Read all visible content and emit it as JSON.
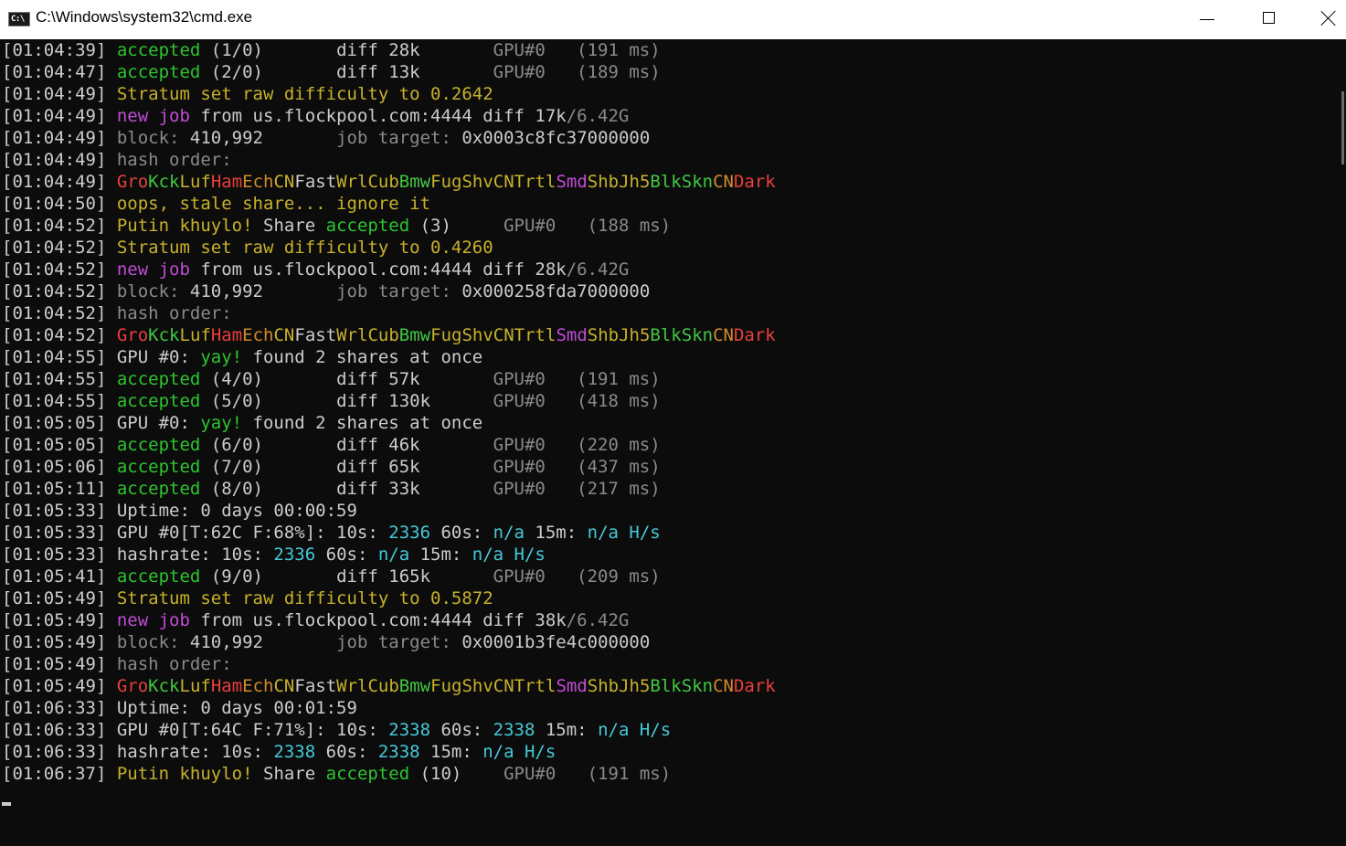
{
  "window": {
    "title": "C:\\Windows\\system32\\cmd.exe",
    "icon": "cmd-app-icon",
    "icon_text": "C:\\"
  },
  "colors": {
    "w": "#cccccc",
    "g": "#2ec52e",
    "y": "#c8b12c",
    "r": "#e8403c",
    "m": "#c24bd6",
    "d": "#8a8a8a",
    "c": "#47c8d8",
    "o": "#d08a2a",
    "W": "#f2f2f2",
    "G": "#40c840"
  },
  "console": {
    "lines": [
      [
        [
          "w",
          "[01:04:39] "
        ],
        [
          "g",
          "accepted"
        ],
        [
          "w",
          " (1/0)       diff 28k       "
        ],
        [
          "d",
          "GPU#0   (191 ms)"
        ]
      ],
      [
        [
          "w",
          "[01:04:47] "
        ],
        [
          "g",
          "accepted"
        ],
        [
          "w",
          " (2/0)       diff 13k       "
        ],
        [
          "d",
          "GPU#0   (189 ms)"
        ]
      ],
      [
        [
          "w",
          "[01:04:49] "
        ],
        [
          "y",
          "Stratum set raw difficulty to 0.2642"
        ]
      ],
      [
        [
          "w",
          "[01:04:49] "
        ],
        [
          "m",
          "new job"
        ],
        [
          "w",
          " from us.flockpool.com:4444 diff 17k"
        ],
        [
          "d",
          "/6.42G"
        ]
      ],
      [
        [
          "w",
          "[01:04:49] "
        ],
        [
          "d",
          "block: "
        ],
        [
          "w",
          "410,992       "
        ],
        [
          "d",
          "job target: "
        ],
        [
          "w",
          "0x0003c8fc37000000"
        ]
      ],
      [
        [
          "w",
          "[01:04:49] "
        ],
        [
          "d",
          "hash order:"
        ]
      ],
      [
        [
          "w",
          "[01:04:49] "
        ],
        [
          "r",
          "Gro"
        ],
        [
          "G",
          "Kck"
        ],
        [
          "y",
          "Luf"
        ],
        [
          "r",
          "Ham"
        ],
        [
          "o",
          "Ech"
        ],
        [
          "y",
          "CN"
        ],
        [
          "w",
          "Fast"
        ],
        [
          "y",
          "Wrl"
        ],
        [
          "y",
          "Cub"
        ],
        [
          "G",
          "Bmw"
        ],
        [
          "y",
          "Fug"
        ],
        [
          "y",
          "Shv"
        ],
        [
          "y",
          "CN"
        ],
        [
          "y",
          "Trtl"
        ],
        [
          "m",
          "Smd"
        ],
        [
          "y",
          "Shb"
        ],
        [
          "y",
          "Jh5"
        ],
        [
          "G",
          "Blk"
        ],
        [
          "G",
          "Skn"
        ],
        [
          "o",
          "CN"
        ],
        [
          "r",
          "Dark"
        ]
      ],
      [
        [
          "w",
          "[01:04:50] "
        ],
        [
          "y",
          "oops, stale share... ignore it"
        ]
      ],
      [
        [
          "w",
          "[01:04:52] "
        ],
        [
          "y",
          "Putin khuylo!"
        ],
        [
          "w",
          " Share "
        ],
        [
          "g",
          "accepted"
        ],
        [
          "w",
          " (3)     "
        ],
        [
          "d",
          "GPU#0   (188 ms)"
        ]
      ],
      [
        [
          "w",
          "[01:04:52] "
        ],
        [
          "y",
          "Stratum set raw difficulty to 0.4260"
        ]
      ],
      [
        [
          "w",
          "[01:04:52] "
        ],
        [
          "m",
          "new job"
        ],
        [
          "w",
          " from us.flockpool.com:4444 diff 28k"
        ],
        [
          "d",
          "/6.42G"
        ]
      ],
      [
        [
          "w",
          "[01:04:52] "
        ],
        [
          "d",
          "block: "
        ],
        [
          "w",
          "410,992       "
        ],
        [
          "d",
          "job target: "
        ],
        [
          "w",
          "0x000258fda7000000"
        ]
      ],
      [
        [
          "w",
          "[01:04:52] "
        ],
        [
          "d",
          "hash order:"
        ]
      ],
      [
        [
          "w",
          "[01:04:52] "
        ],
        [
          "r",
          "Gro"
        ],
        [
          "G",
          "Kck"
        ],
        [
          "y",
          "Luf"
        ],
        [
          "r",
          "Ham"
        ],
        [
          "o",
          "Ech"
        ],
        [
          "y",
          "CN"
        ],
        [
          "w",
          "Fast"
        ],
        [
          "y",
          "Wrl"
        ],
        [
          "y",
          "Cub"
        ],
        [
          "G",
          "Bmw"
        ],
        [
          "y",
          "Fug"
        ],
        [
          "y",
          "Shv"
        ],
        [
          "y",
          "CN"
        ],
        [
          "y",
          "Trtl"
        ],
        [
          "m",
          "Smd"
        ],
        [
          "y",
          "Shb"
        ],
        [
          "y",
          "Jh5"
        ],
        [
          "G",
          "Blk"
        ],
        [
          "G",
          "Skn"
        ],
        [
          "o",
          "CN"
        ],
        [
          "r",
          "Dark"
        ]
      ],
      [
        [
          "w",
          "[01:04:55] GPU #0: "
        ],
        [
          "g",
          "yay!"
        ],
        [
          "w",
          " found 2 shares at once"
        ]
      ],
      [
        [
          "w",
          "[01:04:55] "
        ],
        [
          "g",
          "accepted"
        ],
        [
          "w",
          " (4/0)       diff 57k       "
        ],
        [
          "d",
          "GPU#0   (191 ms)"
        ]
      ],
      [
        [
          "w",
          "[01:04:55] "
        ],
        [
          "g",
          "accepted"
        ],
        [
          "w",
          " (5/0)       diff 130k      "
        ],
        [
          "d",
          "GPU#0   (418 ms)"
        ]
      ],
      [
        [
          "w",
          "[01:05:05] GPU #0: "
        ],
        [
          "g",
          "yay!"
        ],
        [
          "w",
          " found 2 shares at once"
        ]
      ],
      [
        [
          "w",
          "[01:05:05] "
        ],
        [
          "g",
          "accepted"
        ],
        [
          "w",
          " (6/0)       diff 46k       "
        ],
        [
          "d",
          "GPU#0   (220 ms)"
        ]
      ],
      [
        [
          "w",
          "[01:05:06] "
        ],
        [
          "g",
          "accepted"
        ],
        [
          "w",
          " (7/0)       diff 65k       "
        ],
        [
          "d",
          "GPU#0   (437 ms)"
        ]
      ],
      [
        [
          "w",
          "[01:05:11] "
        ],
        [
          "g",
          "accepted"
        ],
        [
          "w",
          " (8/0)       diff 33k       "
        ],
        [
          "d",
          "GPU#0   (217 ms)"
        ]
      ],
      [
        [
          "w",
          "[01:05:33] Uptime: 0 days 00:00:59"
        ]
      ],
      [
        [
          "w",
          "[01:05:33] GPU #0[T:62C F:68%]: 10s: "
        ],
        [
          "c",
          "2336"
        ],
        [
          "w",
          " 60s: "
        ],
        [
          "c",
          "n/a"
        ],
        [
          "w",
          " 15m: "
        ],
        [
          "c",
          "n/a H/s"
        ]
      ],
      [
        [
          "w",
          "[01:05:33] hashrate: 10s: "
        ],
        [
          "c",
          "2336"
        ],
        [
          "w",
          " 60s: "
        ],
        [
          "c",
          "n/a"
        ],
        [
          "w",
          " 15m: "
        ],
        [
          "c",
          "n/a H/s"
        ]
      ],
      [
        [
          "w",
          "[01:05:41] "
        ],
        [
          "g",
          "accepted"
        ],
        [
          "w",
          " (9/0)       diff 165k      "
        ],
        [
          "d",
          "GPU#0   (209 ms)"
        ]
      ],
      [
        [
          "w",
          "[01:05:49] "
        ],
        [
          "y",
          "Stratum set raw difficulty to 0.5872"
        ]
      ],
      [
        [
          "w",
          "[01:05:49] "
        ],
        [
          "m",
          "new job"
        ],
        [
          "w",
          " from us.flockpool.com:4444 diff 38k"
        ],
        [
          "d",
          "/6.42G"
        ]
      ],
      [
        [
          "w",
          "[01:05:49] "
        ],
        [
          "d",
          "block: "
        ],
        [
          "w",
          "410,992       "
        ],
        [
          "d",
          "job target: "
        ],
        [
          "w",
          "0x0001b3fe4c000000"
        ]
      ],
      [
        [
          "w",
          "[01:05:49] "
        ],
        [
          "d",
          "hash order:"
        ]
      ],
      [
        [
          "w",
          "[01:05:49] "
        ],
        [
          "r",
          "Gro"
        ],
        [
          "G",
          "Kck"
        ],
        [
          "y",
          "Luf"
        ],
        [
          "r",
          "Ham"
        ],
        [
          "o",
          "Ech"
        ],
        [
          "y",
          "CN"
        ],
        [
          "w",
          "Fast"
        ],
        [
          "y",
          "Wrl"
        ],
        [
          "y",
          "Cub"
        ],
        [
          "G",
          "Bmw"
        ],
        [
          "y",
          "Fug"
        ],
        [
          "y",
          "Shv"
        ],
        [
          "y",
          "CN"
        ],
        [
          "y",
          "Trtl"
        ],
        [
          "m",
          "Smd"
        ],
        [
          "y",
          "Shb"
        ],
        [
          "y",
          "Jh5"
        ],
        [
          "G",
          "Blk"
        ],
        [
          "G",
          "Skn"
        ],
        [
          "o",
          "CN"
        ],
        [
          "r",
          "Dark"
        ]
      ],
      [
        [
          "w",
          "[01:06:33] Uptime: 0 days 00:01:59"
        ]
      ],
      [
        [
          "w",
          "[01:06:33] GPU #0[T:64C F:71%]: 10s: "
        ],
        [
          "c",
          "2338"
        ],
        [
          "w",
          " 60s: "
        ],
        [
          "c",
          "2338"
        ],
        [
          "w",
          " 15m: "
        ],
        [
          "c",
          "n/a H/s"
        ]
      ],
      [
        [
          "w",
          "[01:06:33] hashrate: 10s: "
        ],
        [
          "c",
          "2338"
        ],
        [
          "w",
          " 60s: "
        ],
        [
          "c",
          "2338"
        ],
        [
          "w",
          " 15m: "
        ],
        [
          "c",
          "n/a H/s"
        ]
      ],
      [
        [
          "w",
          "[01:06:37] "
        ],
        [
          "y",
          "Putin khuylo!"
        ],
        [
          "w",
          " Share "
        ],
        [
          "g",
          "accepted"
        ],
        [
          "w",
          " (10)    "
        ],
        [
          "d",
          "GPU#0   (191 ms)"
        ]
      ]
    ]
  }
}
